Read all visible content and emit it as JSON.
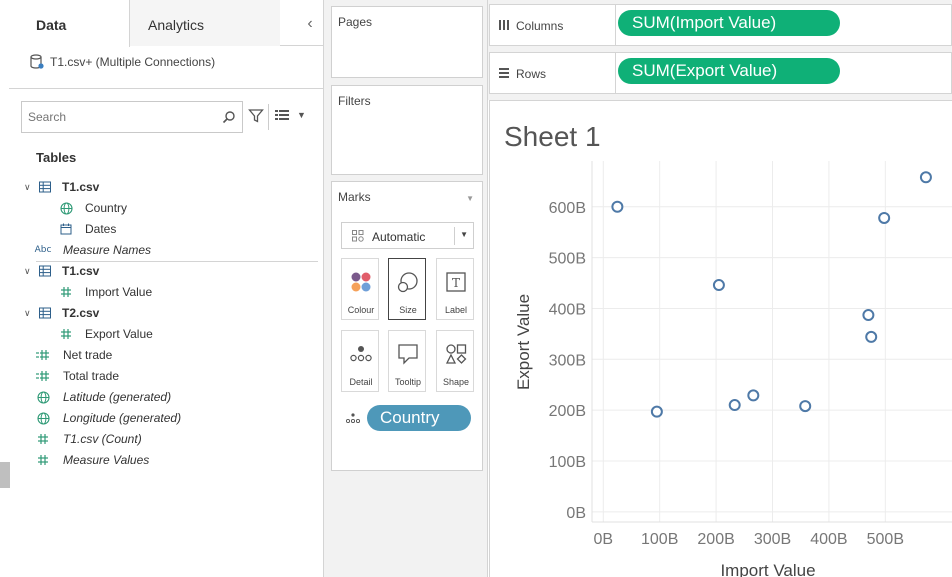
{
  "left_pane": {
    "tabs": [
      "Data",
      "Analytics"
    ],
    "collapse_glyph": "‹",
    "datasource": "T1.csv+ (Multiple Connections)",
    "search_placeholder": "Search",
    "tables_heading": "Tables",
    "fields": [
      {
        "label": "T1.csv",
        "kind": "table",
        "icon": "table-icon",
        "chevron": true,
        "bold": true,
        "italic": false
      },
      {
        "label": "Country",
        "kind": "dimension",
        "icon": "globe-icon",
        "chevron": false,
        "bold": false,
        "italic": false
      },
      {
        "label": "Dates",
        "kind": "dimension",
        "icon": "calendar-icon",
        "chevron": false,
        "bold": false,
        "italic": false
      },
      {
        "label": "Measure Names",
        "kind": "dimension",
        "icon": "abc-icon",
        "icon_text": "Abc",
        "chevron": false,
        "bold": false,
        "italic": true
      },
      {
        "label": "T1.csv",
        "kind": "table",
        "icon": "table-icon",
        "chevron": true,
        "bold": true,
        "italic": false
      },
      {
        "label": "Import Value",
        "kind": "measure",
        "icon": "hash-icon",
        "chevron": false,
        "bold": false,
        "italic": false
      },
      {
        "label": "T2.csv",
        "kind": "table",
        "icon": "table-icon",
        "chevron": true,
        "bold": true,
        "italic": false
      },
      {
        "label": "Export Value",
        "kind": "measure",
        "icon": "hash-icon",
        "chevron": false,
        "bold": false,
        "italic": false
      },
      {
        "label": "Net trade",
        "kind": "calc",
        "icon": "calc-measure-icon",
        "chevron": false,
        "bold": false,
        "italic": false
      },
      {
        "label": "Total trade",
        "kind": "calc",
        "icon": "calc-measure-icon",
        "chevron": false,
        "bold": false,
        "italic": false
      },
      {
        "label": "Latitude (generated)",
        "kind": "geo",
        "icon": "globe-icon",
        "chevron": false,
        "bold": false,
        "italic": true
      },
      {
        "label": "Longitude (generated)",
        "kind": "geo",
        "icon": "globe-icon",
        "chevron": false,
        "bold": false,
        "italic": true
      },
      {
        "label": "T1.csv (Count)",
        "kind": "measure",
        "icon": "hash-icon",
        "chevron": false,
        "bold": false,
        "italic": true
      },
      {
        "label": "Measure Values",
        "kind": "measure",
        "icon": "hash-icon",
        "chevron": false,
        "bold": false,
        "italic": true
      }
    ]
  },
  "cards": {
    "pages": "Pages",
    "filters": "Filters",
    "marks": "Marks",
    "mark_type": "Automatic",
    "mark_buttons": [
      {
        "label": "Colour",
        "icon": "colour-icon"
      },
      {
        "label": "Size",
        "icon": "size-icon"
      },
      {
        "label": "Label",
        "icon": "label-icon"
      },
      {
        "label": "Detail",
        "icon": "detail-icon"
      },
      {
        "label": "Tooltip",
        "icon": "tooltip-icon"
      },
      {
        "label": "Shape",
        "icon": "shape-icon"
      }
    ],
    "detail_pill": "Country"
  },
  "shelves": {
    "columns_label": "Columns",
    "columns_pill": "SUM(Import Value)",
    "rows_label": "Rows",
    "rows_pill": "SUM(Export Value)"
  },
  "colors": {
    "measure_pill": "#0fb077",
    "dimension_pill": "#4e98b9",
    "mark_stroke": "#4e79a7",
    "grid": "#ececec"
  },
  "chart_data": {
    "type": "scatter",
    "title": "Sheet 1",
    "xlabel": "Import Value",
    "ylabel": "Export Value",
    "xlim": [
      -20,
      620
    ],
    "ylim": [
      -20,
      690
    ],
    "x_ticks": [
      0,
      100,
      200,
      300,
      400,
      500
    ],
    "x_tick_labels": [
      "0B",
      "100B",
      "200B",
      "300B",
      "400B",
      "500B"
    ],
    "y_ticks": [
      0,
      100,
      200,
      300,
      400,
      500,
      600
    ],
    "y_tick_labels": [
      "0B",
      "100B",
      "200B",
      "300B",
      "400B",
      "500B",
      "600B"
    ],
    "grid": true,
    "series": [
      {
        "points": [
          {
            "x": 25,
            "y": 600
          },
          {
            "x": 95,
            "y": 197
          },
          {
            "x": 205,
            "y": 446
          },
          {
            "x": 233,
            "y": 210
          },
          {
            "x": 266,
            "y": 229
          },
          {
            "x": 358,
            "y": 208
          },
          {
            "x": 470,
            "y": 387
          },
          {
            "x": 475,
            "y": 344
          },
          {
            "x": 498,
            "y": 578
          },
          {
            "x": 572,
            "y": 658
          }
        ]
      }
    ]
  }
}
